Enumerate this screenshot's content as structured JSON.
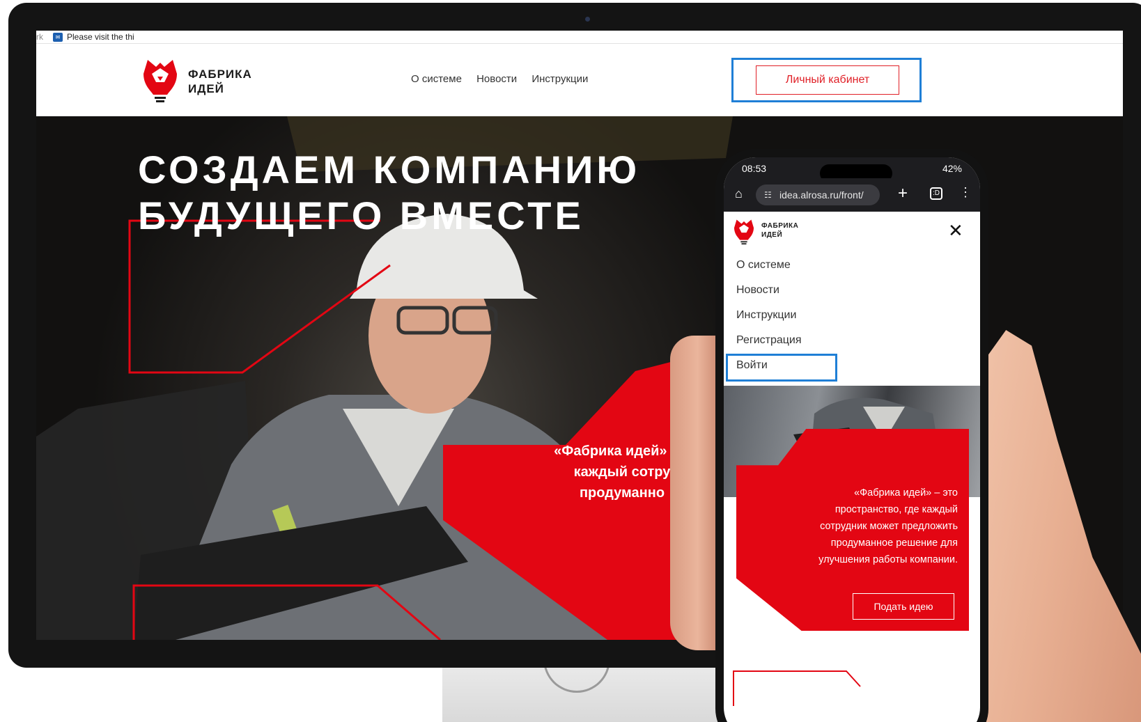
{
  "browser": {
    "tab_fragment_left": "rk",
    "tab_title": "Please visit the thi"
  },
  "site": {
    "logo_line1": "ФАБРИКА",
    "logo_line2": "ИДЕЙ",
    "nav": [
      "О системе",
      "Новости",
      "Инструкции"
    ],
    "cabinet_label": "Личный кабинет",
    "hero_title_line1": "СОЗДАЕМ КОМПАНИЮ",
    "hero_title_line2": "БУДУЩЕГО ВМЕСТЕ",
    "hero_text_lines": [
      "«Фабрика идей» – э",
      "каждый сотру",
      "продуманно"
    ]
  },
  "phone": {
    "time": "08:53",
    "battery": "42%",
    "url": "idea.alrosa.ru/front/",
    "tabs_count": ":D",
    "logo_line1": "ФАБРИКА",
    "logo_line2": "ИДЕЙ",
    "menu": [
      "О системе",
      "Новости",
      "Инструкции",
      "Регистрация",
      "Войти"
    ],
    "description_lines": [
      "«Фабрика идей» – это",
      "пространство, где каждый",
      "сотрудник может предложить",
      "продуманное решение для",
      "улучшения работы компании."
    ],
    "cta_label": "Подать идею"
  },
  "colors": {
    "brand_red": "#e30613",
    "highlight_blue": "#1f7fd6"
  },
  "icons": {
    "close": "close-icon",
    "home": "home-icon",
    "plus": "plus-icon",
    "menu": "kebab-menu-icon"
  }
}
